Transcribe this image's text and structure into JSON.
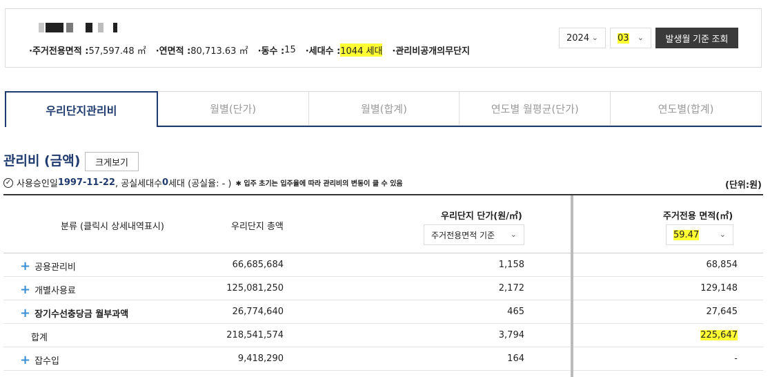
{
  "summary": {
    "stats": [
      {
        "key": "·주거전용면적 : ",
        "value": "57,597.48 ㎡"
      },
      {
        "key": "·연면적 : ",
        "value": "80,713.63 ㎡"
      },
      {
        "key": "·동수 : ",
        "value": "15"
      },
      {
        "key": "·세대수 : ",
        "value": "1044 세대"
      },
      {
        "key": "·관리비공개의무단지",
        "value": ""
      }
    ],
    "year": "2024",
    "month": "03",
    "query_button": "발생월 기준 조회"
  },
  "tabs": [
    "우리단지관리비",
    "월별(단가)",
    "월별(합계)",
    "연도별 월평균(단가)",
    "연도별(합계)"
  ],
  "section": {
    "title": "관리비 (금액)",
    "big_button": "크게보기",
    "info_prefix": "사용승인일 ",
    "approval_date": "1997-11-22",
    "info_mid": ", 공실세대수 ",
    "vacant_count": "0",
    "info_suffix": "세대 (공실율: - )",
    "note": "✱ 입주 초기는 입주율에 따라 관리비의 변동이 클 수 있음",
    "unit": "(단위:원)"
  },
  "table": {
    "headers": {
      "category": "분류 (클릭시 상세내역표시)",
      "total": "우리단지 총액",
      "unit_price": "우리단지 단가(원/㎡)",
      "unit_price_select": "주거전용면적 기준",
      "area": "주거전용 면적(㎡)",
      "area_select": "59.47"
    },
    "rows": [
      {
        "label": "공용관리비",
        "expandable": true,
        "bold": false,
        "total": "66,685,684",
        "unit_price": "1,158",
        "area_value": "68,854"
      },
      {
        "label": "개별사용료",
        "expandable": true,
        "bold": false,
        "total": "125,081,250",
        "unit_price": "2,172",
        "area_value": "129,148"
      },
      {
        "label": "장기수선충당금 월부과액",
        "expandable": true,
        "bold": true,
        "total": "26,774,640",
        "unit_price": "465",
        "area_value": "27,645"
      },
      {
        "label": "합계",
        "expandable": false,
        "bold": false,
        "total": "218,541,574",
        "unit_price": "3,794",
        "area_value": "225,647"
      },
      {
        "label": "잡수입",
        "expandable": true,
        "bold": false,
        "total": "9,418,290",
        "unit_price": "164",
        "area_value": "-"
      }
    ]
  },
  "colors": {
    "navy": "#1f3a6e",
    "plus_blue": "#3a8ed8",
    "highlight": "#ffff33",
    "button_dark": "#3a3a3a"
  }
}
